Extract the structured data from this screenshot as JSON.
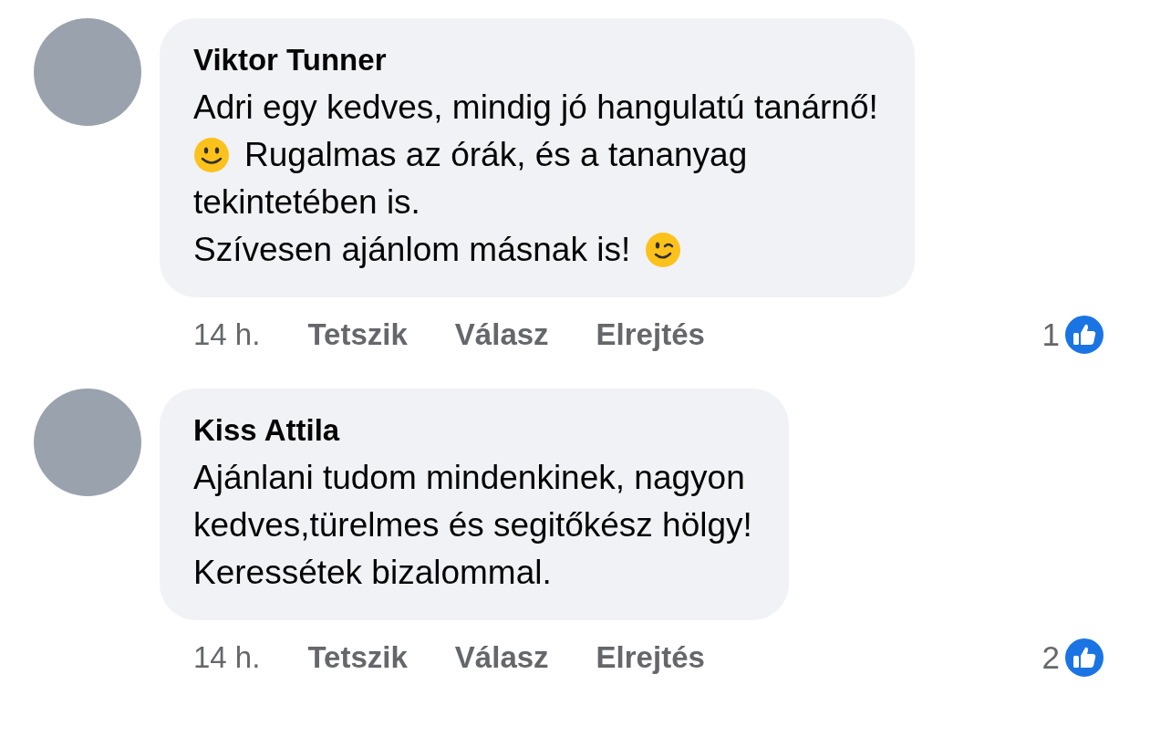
{
  "comments": [
    {
      "author": "Viktor Tunner",
      "lines": [
        [
          {
            "kind": "text",
            "text": "Adri egy kedves, mindig jó hangulatú tanárnő!"
          }
        ],
        [
          {
            "kind": "smile"
          },
          {
            "kind": "text",
            "text": "Rugalmas az órák, és a tananyag"
          }
        ],
        [
          {
            "kind": "text",
            "text": "tekintetében is."
          }
        ],
        [
          {
            "kind": "text",
            "text": "Szívesen ajánlom másnak is!"
          },
          {
            "kind": "wink"
          }
        ]
      ],
      "time": "14 h.",
      "actions": [
        "Tetszik",
        "Válasz",
        "Elrejtés"
      ],
      "likes": "1"
    },
    {
      "author": "Kiss Attila",
      "lines": [
        [
          {
            "kind": "text",
            "text": "Ajánlani tudom mindenkinek, nagyon"
          }
        ],
        [
          {
            "kind": "text",
            "text": "kedves,türelmes és segitőkész hölgy!"
          }
        ],
        [
          {
            "kind": "text",
            "text": "Keressétek bizalommal."
          }
        ]
      ],
      "time": "14 h.",
      "actions": [
        "Tetszik",
        "Válasz",
        "Elrejtés"
      ],
      "likes": "2"
    }
  ]
}
